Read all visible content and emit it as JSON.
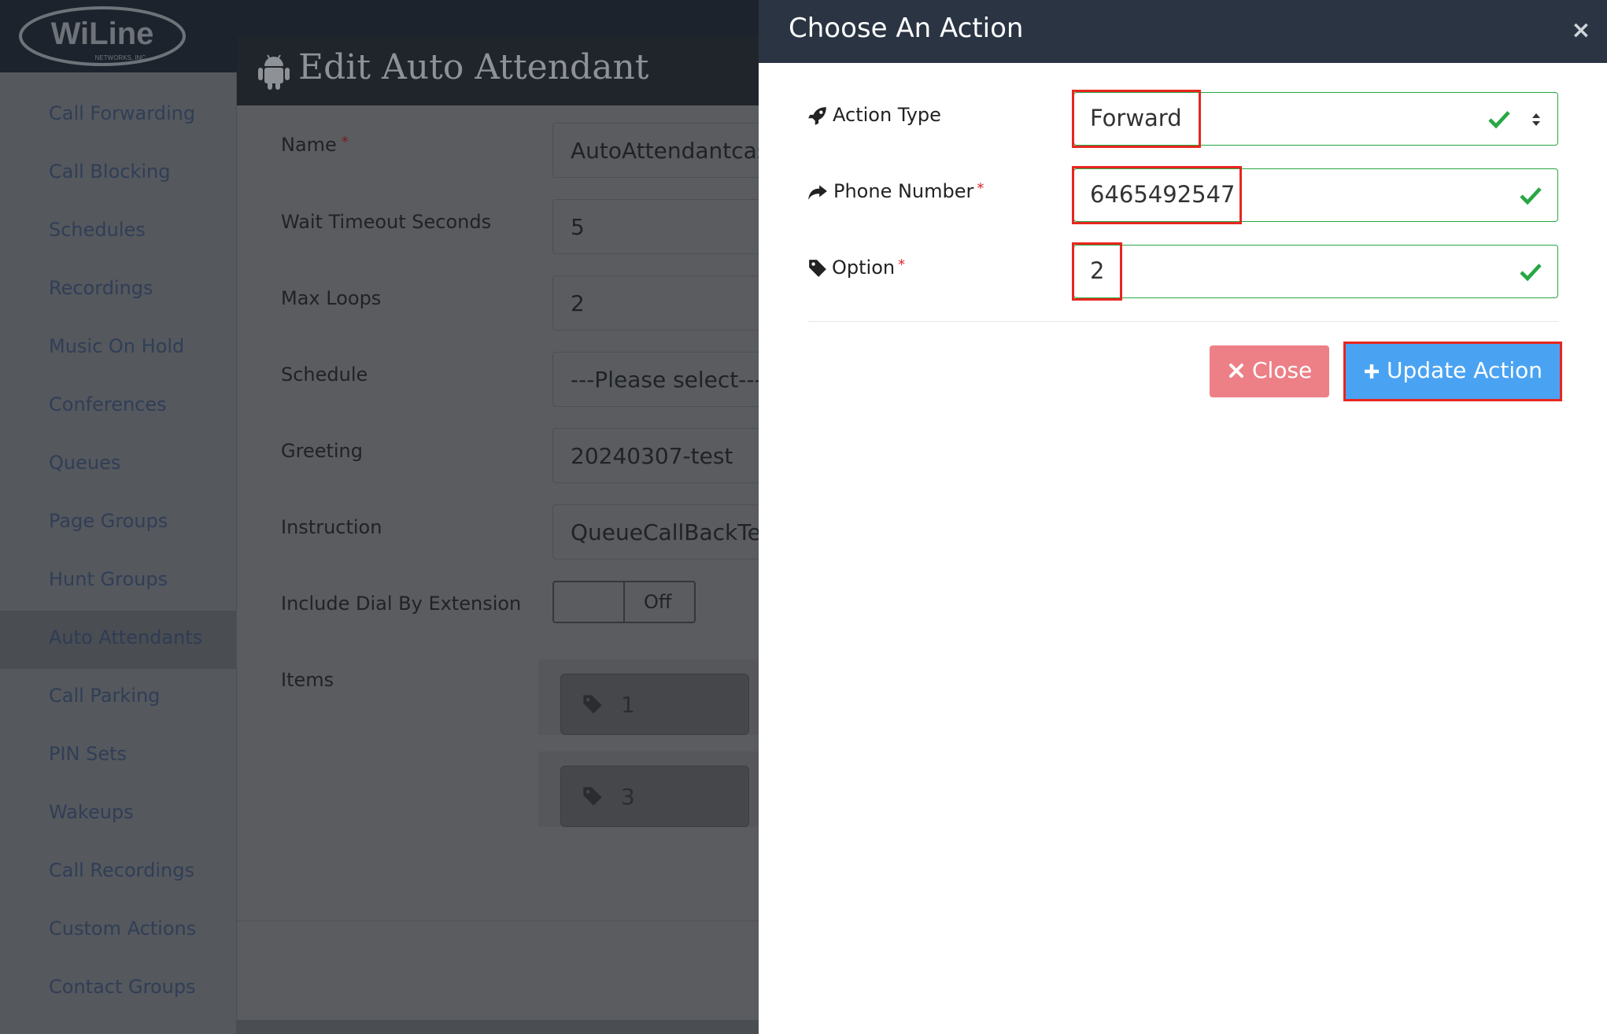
{
  "header": {
    "logo_text": "WiLine",
    "logo_subtext": "NETWORKS, INC."
  },
  "sidebar": {
    "items": [
      {
        "label": "Call Forwarding"
      },
      {
        "label": "Call Blocking"
      },
      {
        "label": "Schedules"
      },
      {
        "label": "Recordings"
      },
      {
        "label": "Music On Hold"
      },
      {
        "label": "Conferences"
      },
      {
        "label": "Queues"
      },
      {
        "label": "Page Groups"
      },
      {
        "label": "Hunt Groups"
      },
      {
        "label": "Auto Attendants"
      },
      {
        "label": "Call Parking"
      },
      {
        "label": "PIN Sets"
      },
      {
        "label": "Wakeups"
      },
      {
        "label": "Call Recordings"
      },
      {
        "label": "Custom Actions"
      },
      {
        "label": "Contact Groups"
      }
    ],
    "active": "Auto Attendants"
  },
  "edit_modal": {
    "title": "Edit Auto Attendant",
    "fields": {
      "name_label": "Name",
      "name_value": "AutoAttendantcase",
      "wait_label": "Wait Timeout Seconds",
      "wait_value": "5",
      "loops_label": "Max Loops",
      "loops_value": "2",
      "schedule_label": "Schedule",
      "schedule_value": "---Please select---",
      "greeting_label": "Greeting",
      "greeting_value": "20240307-test",
      "instruction_label": "Instruction",
      "instruction_value": "QueueCallBackTest",
      "dial_ext_label": "Include Dial By Extension",
      "dial_ext_state": "Off",
      "items_label": "Items"
    },
    "items": [
      "1",
      "3"
    ],
    "required_mark": "*"
  },
  "action_modal": {
    "title": "Choose An Action",
    "close_glyph": "×",
    "action_type_label": "Action Type",
    "action_type_value": "Forward",
    "phone_label": "Phone Number",
    "phone_value": "6465492547",
    "option_label": "Option",
    "option_value": "2",
    "required_mark": "*",
    "close_button": "Close",
    "update_button": "Update Action"
  },
  "colors": {
    "valid": "#28a745",
    "highlight": "#e8251f",
    "primary": "#4aa3f2",
    "danger": "#ed7f86",
    "header_dark": "#2a3443"
  },
  "icons": [
    "android-icon",
    "rocket-icon",
    "share-icon",
    "tag-icon",
    "check-icon",
    "sort-caret-icon",
    "close-icon",
    "plus-icon"
  ]
}
